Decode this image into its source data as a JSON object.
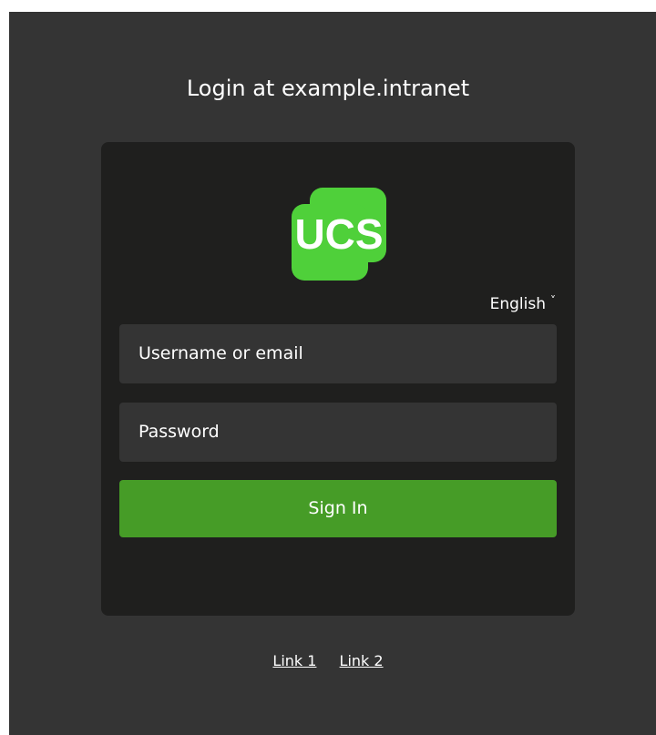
{
  "header": {
    "title": "Login at example.intranet"
  },
  "logo": {
    "text": "UCS",
    "color": "#4fd03a"
  },
  "language": {
    "selected": "English",
    "chevron": "˅"
  },
  "form": {
    "username_placeholder": "Username or email",
    "password_placeholder": "Password",
    "submit_label": "Sign In"
  },
  "footer": {
    "links": [
      {
        "label": "Link 1"
      },
      {
        "label": "Link 2"
      }
    ]
  },
  "colors": {
    "background": "#343434",
    "card": "#1f1f1e",
    "field": "#343434",
    "button": "#469c27",
    "text": "#ffffff"
  }
}
